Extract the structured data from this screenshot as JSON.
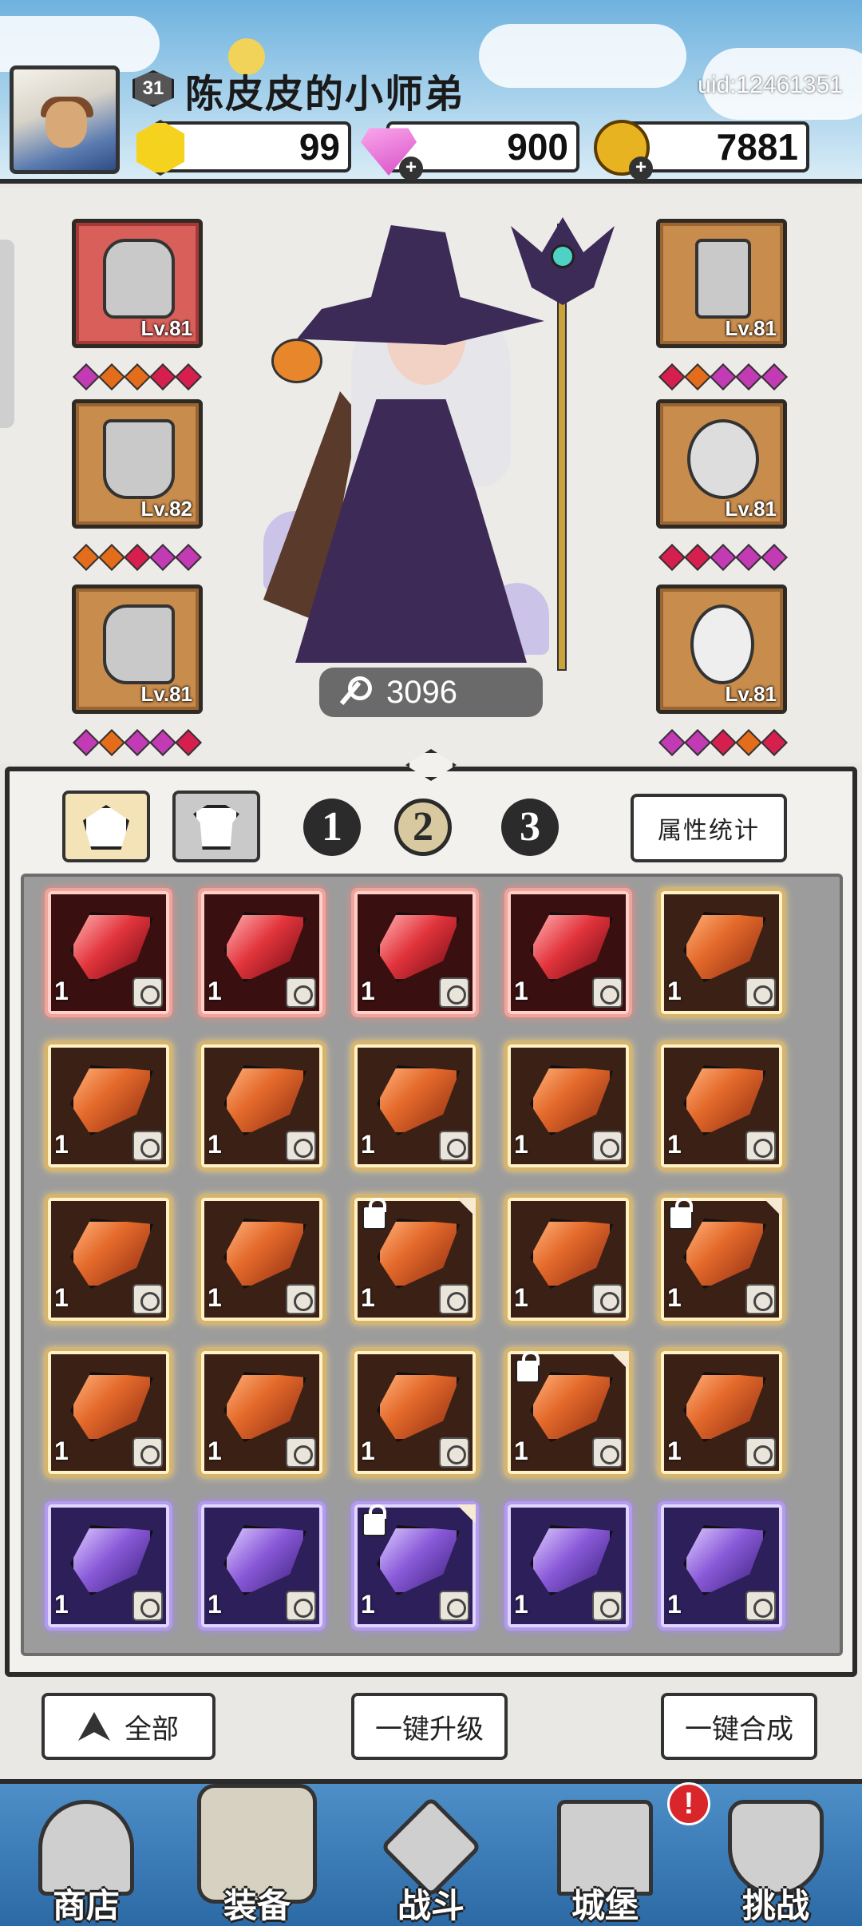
{
  "player": {
    "name": "陈皮皮的小师弟",
    "level": "31",
    "uid": "uid:12461351"
  },
  "currencies": [
    {
      "name": "gold-hexagon",
      "value": "99"
    },
    {
      "name": "diamond",
      "value": "900"
    },
    {
      "name": "coin",
      "value": "7881"
    }
  ],
  "equipment_slots": {
    "left": [
      {
        "icon": "helmet-icon",
        "level": "Lv.81"
      },
      {
        "icon": "cape-icon",
        "level": "Lv.82"
      },
      {
        "icon": "boot-icon",
        "level": "Lv.81"
      }
    ],
    "right": [
      {
        "icon": "bone-icon",
        "level": "Lv.81"
      },
      {
        "icon": "ring-icon",
        "level": "Lv.81"
      },
      {
        "icon": "necklace-icon",
        "level": "Lv.81"
      }
    ]
  },
  "power": "3096",
  "inventory": {
    "tabs": [
      "gem-tab",
      "shirt-tab"
    ],
    "pages": [
      "1",
      "2",
      "3"
    ],
    "active_page": "2",
    "stats_button": "属性统计",
    "grid": [
      [
        {
          "q": "1",
          "r": "red"
        },
        {
          "q": "1",
          "r": "red"
        },
        {
          "q": "1",
          "r": "red"
        },
        {
          "q": "1",
          "r": "red"
        },
        {
          "q": "1",
          "r": "orange"
        }
      ],
      [
        {
          "q": "1",
          "r": "orange"
        },
        {
          "q": "1",
          "r": "orange"
        },
        {
          "q": "1",
          "r": "orange"
        },
        {
          "q": "1",
          "r": "orange"
        },
        {
          "q": "1",
          "r": "orange"
        }
      ],
      [
        {
          "q": "1",
          "r": "orange"
        },
        {
          "q": "1",
          "r": "orange"
        },
        {
          "q": "1",
          "r": "orange",
          "lock": true
        },
        {
          "q": "1",
          "r": "orange"
        },
        {
          "q": "1",
          "r": "orange",
          "lock": true
        }
      ],
      [
        {
          "q": "1",
          "r": "orange"
        },
        {
          "q": "1",
          "r": "orange"
        },
        {
          "q": "1",
          "r": "orange"
        },
        {
          "q": "1",
          "r": "orange",
          "lock": true
        },
        {
          "q": "1",
          "r": "orange"
        }
      ],
      [
        {
          "q": "1",
          "r": "purple"
        },
        {
          "q": "1",
          "r": "purple"
        },
        {
          "q": "1",
          "r": "purple",
          "lock": true
        },
        {
          "q": "1",
          "r": "purple"
        },
        {
          "q": "1",
          "r": "purple"
        }
      ]
    ]
  },
  "actions": {
    "filter_label": "全部",
    "upgrade_label": "一键升级",
    "merge_label": "一键合成"
  },
  "nav": [
    {
      "label": "商店",
      "icon": "shop-icon"
    },
    {
      "label": "装备",
      "icon": "backpack-icon"
    },
    {
      "label": "战斗",
      "icon": "swords-icon"
    },
    {
      "label": "城堡",
      "icon": "castle-icon"
    },
    {
      "label": "挑战",
      "icon": "shield-icon"
    }
  ],
  "alert_badge": "!",
  "colors": {
    "sky": "#6fb2de",
    "orange_gem": "#e46a2b",
    "red_gem": "#e2343c",
    "purple_gem": "#8a5ad9"
  }
}
